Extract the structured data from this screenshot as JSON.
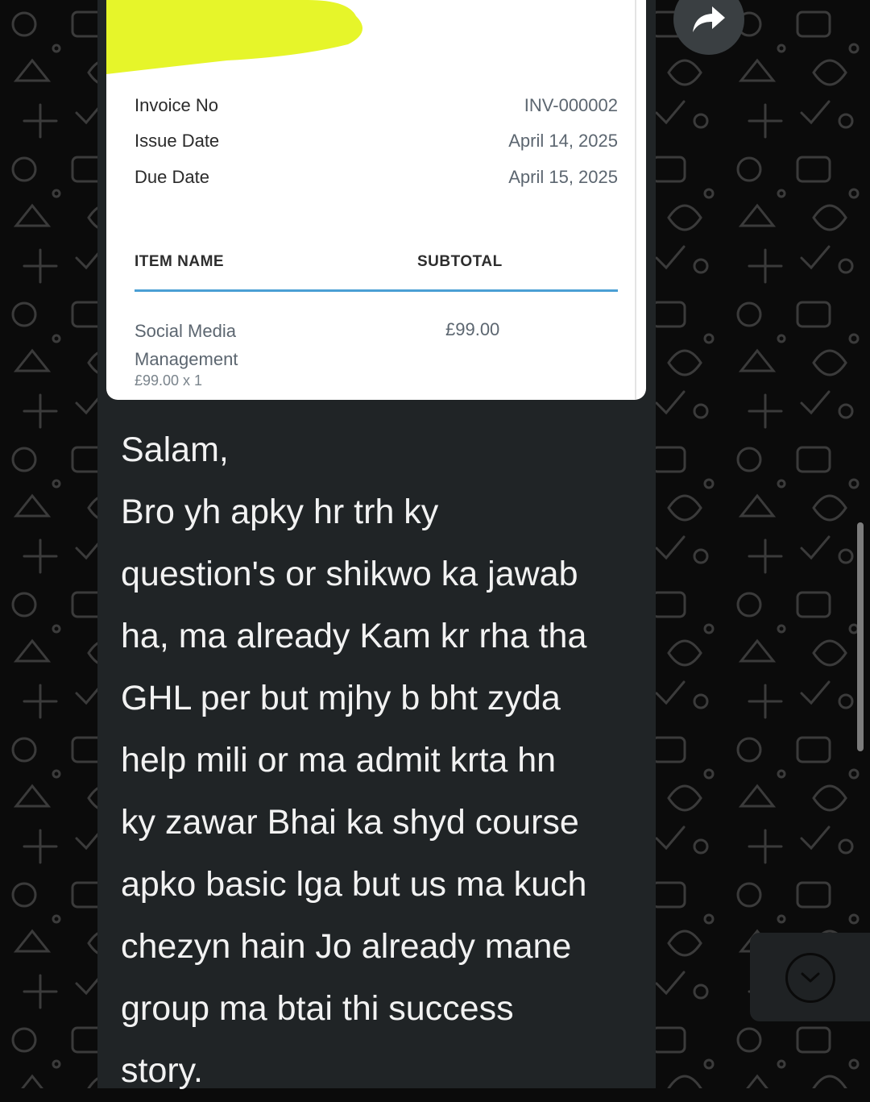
{
  "invoice": {
    "invoice_no_label": "Invoice No",
    "invoice_no_value": "INV-000002",
    "issue_date_label": "Issue Date",
    "issue_date_value": "April 14, 2025",
    "due_date_label": "Due Date",
    "due_date_value": "April 15, 2025",
    "col_item": "ITEM NAME",
    "col_subtotal": "SUBTOTAL",
    "item_name_line1": "Social Media",
    "item_name_line2": "Management",
    "item_qty": "£99.00 x 1",
    "item_subtotal": "£99.00",
    "accent_color": "#4a9fd4",
    "redaction_color": "#e6f52a"
  },
  "message": {
    "lines": [
      "Salam,",
      "Bro yh apky hr trh ky",
      "question's or shikwo ka jawab",
      "ha, ma already Kam kr rha tha",
      "GHL per but mjhy b bht zyda",
      "help mili or ma admit krta hn",
      "ky zawar Bhai ka shyd course",
      "apko basic lga but us ma kuch",
      "chezyn hain Jo already mane",
      "group ma btai thi success",
      "story."
    ]
  },
  "icons": {
    "forward": "forward-arrow-icon",
    "scroll_down": "chevron-down-icon"
  },
  "colors": {
    "bubble_bg": "#202426",
    "wallpaper_bg": "#0b0b0b",
    "text": "#f2f2f2"
  }
}
